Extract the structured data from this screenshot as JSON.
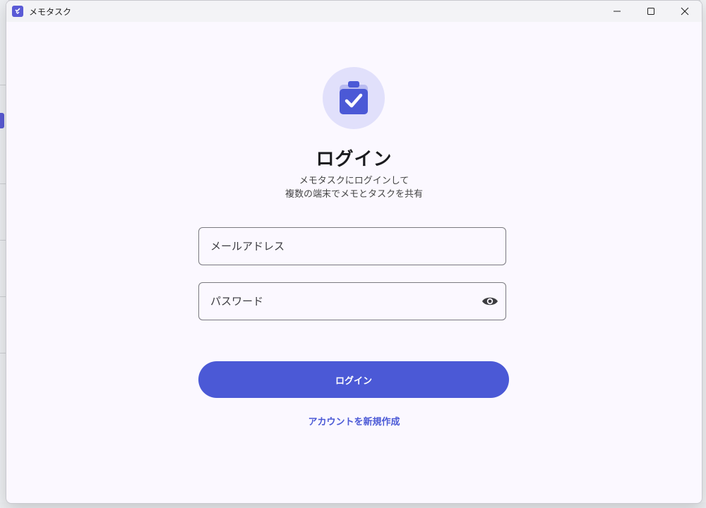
{
  "window": {
    "title": "メモタスク",
    "accent_color": "#4b59d6",
    "controls": [
      "minimize-icon",
      "maximize-icon",
      "close-icon"
    ]
  },
  "login": {
    "logo_icon": "clipboard-check-icon",
    "heading": "ログイン",
    "subtitle_line1": "メモタスクにログインして",
    "subtitle_line2": "複数の端末でメモとタスクを共有",
    "email_placeholder": "メールアドレス",
    "email_value": "",
    "password_placeholder": "パスワード",
    "password_value": "",
    "password_toggle_icon": "eye-icon",
    "submit_label": "ログイン",
    "create_account_label": "アカウントを新規作成"
  }
}
